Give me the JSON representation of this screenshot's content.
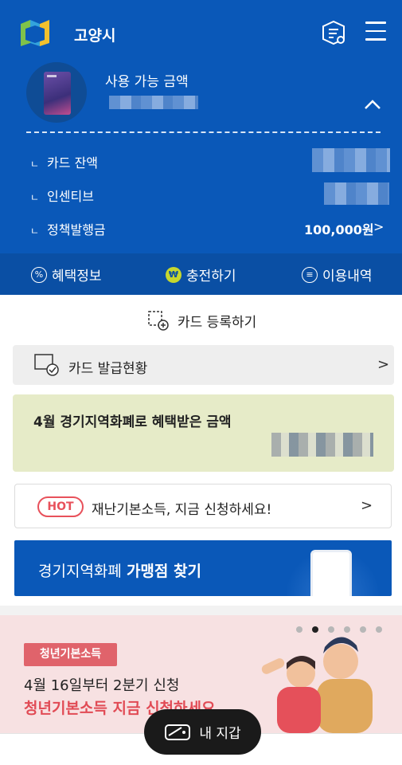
{
  "header": {
    "title": "고양시",
    "icons": [
      "gyeonggi-logo-icon",
      "document-settings-icon",
      "menu-icon"
    ]
  },
  "balance": {
    "available_label": "사용 가능 금액",
    "rows": [
      {
        "label": "카드 잔액"
      },
      {
        "label": "인센티브"
      },
      {
        "label": "정책발행금",
        "value": "100,000원"
      }
    ]
  },
  "actions": [
    {
      "label": "혜택정보",
      "icon": "percent-icon"
    },
    {
      "label": "충전하기",
      "icon": "won-icon"
    },
    {
      "label": "이용내역",
      "icon": "list-icon"
    }
  ],
  "register_card": "카드 등록하기",
  "issuance_status": "카드 발급현황",
  "benefit": {
    "title": "4월 경기지역화폐로 혜택받은 금액"
  },
  "hot": {
    "badge": "HOT",
    "text": "재난기본소득, 지금 신청하세요!"
  },
  "find_store": {
    "prefix": "경기지역화폐",
    "bold": "가맹점 찾기"
  },
  "banner": {
    "tag": "청년기본소득",
    "line1": "4월 16일부터 2분기 신청",
    "line2": "청년기본소득 지금 신청하세요",
    "page_count": 6,
    "active_page": 2
  },
  "wallet_button": "내 지갑",
  "colors": {
    "primary": "#0a58b8",
    "action_bar": "#0a4fa4",
    "benefit_bg": "#e6ebc8",
    "hot": "#e8515b",
    "banner_bg": "#f7e1e2"
  }
}
